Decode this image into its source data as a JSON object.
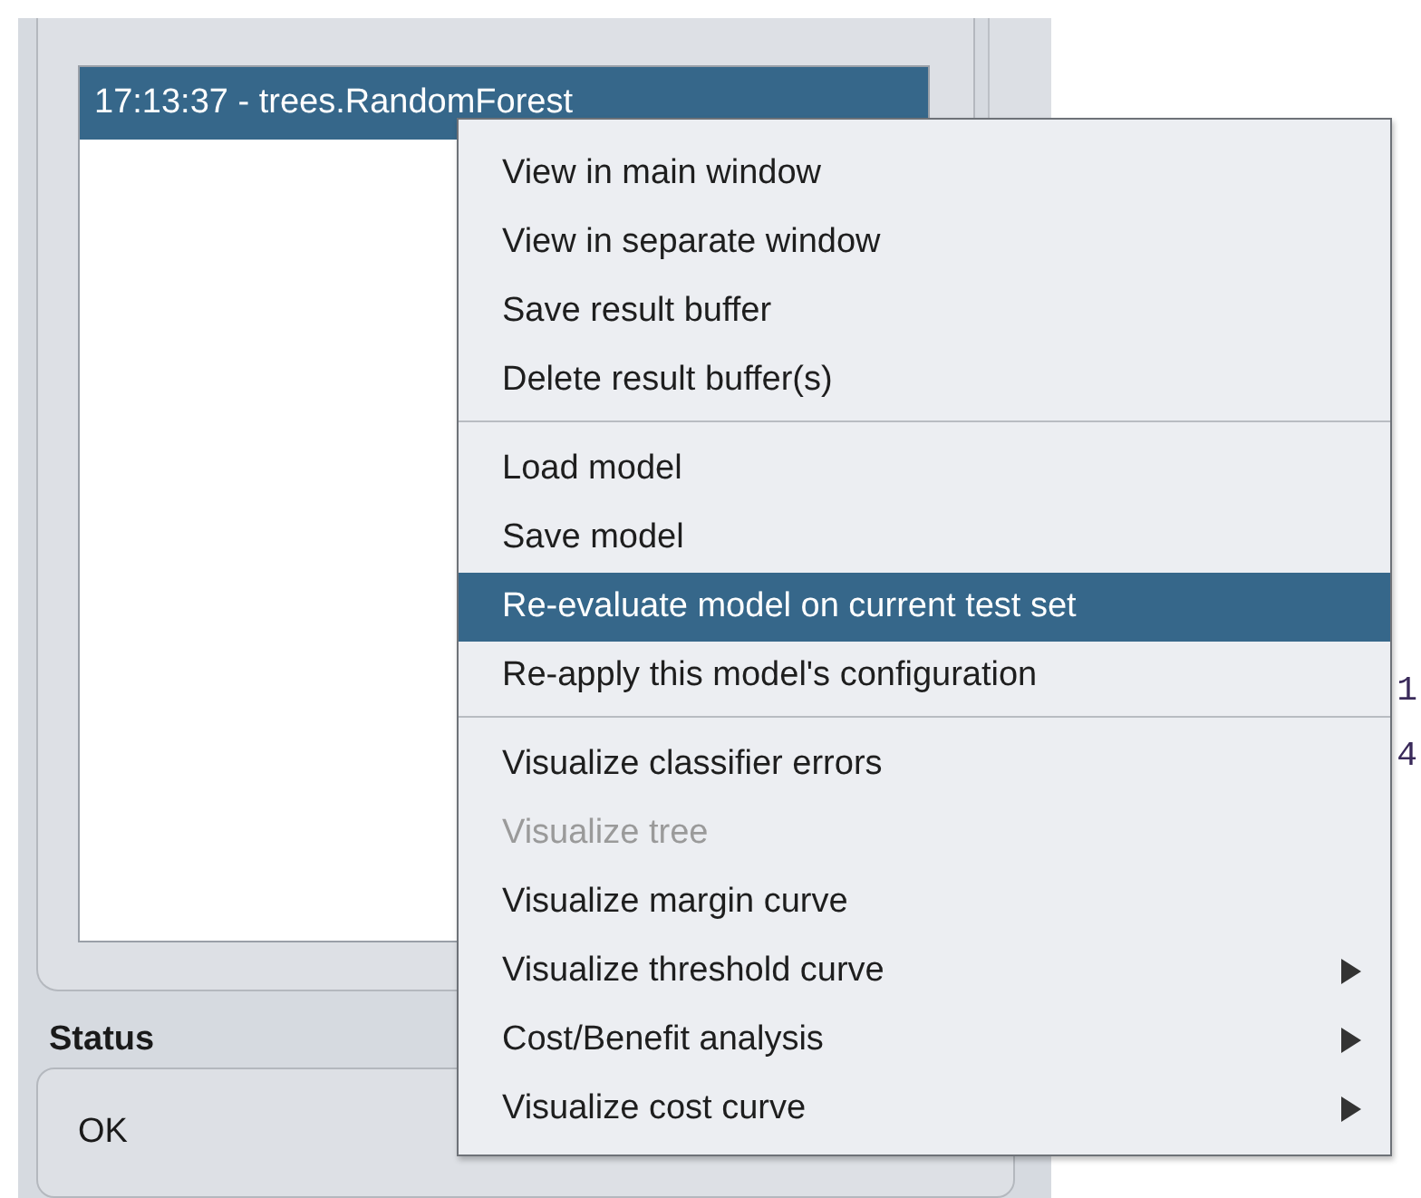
{
  "results": {
    "items": [
      {
        "label": "17:13:37 - trees.RandomForest",
        "selected": true
      }
    ]
  },
  "status": {
    "label": "Status",
    "text": "OK"
  },
  "output_fragments": [
    "1",
    "4"
  ],
  "menu": {
    "groups": [
      {
        "items": [
          {
            "label": "View in main window",
            "selected": false,
            "disabled": false,
            "submenu": false
          },
          {
            "label": "View in separate window",
            "selected": false,
            "disabled": false,
            "submenu": false
          },
          {
            "label": "Save result buffer",
            "selected": false,
            "disabled": false,
            "submenu": false
          },
          {
            "label": "Delete result buffer(s)",
            "selected": false,
            "disabled": false,
            "submenu": false
          }
        ]
      },
      {
        "items": [
          {
            "label": "Load model",
            "selected": false,
            "disabled": false,
            "submenu": false
          },
          {
            "label": "Save model",
            "selected": false,
            "disabled": false,
            "submenu": false
          },
          {
            "label": "Re-evaluate model on current test set",
            "selected": true,
            "disabled": false,
            "submenu": false
          },
          {
            "label": "Re-apply this model's configuration",
            "selected": false,
            "disabled": false,
            "submenu": false
          }
        ]
      },
      {
        "items": [
          {
            "label": "Visualize classifier errors",
            "selected": false,
            "disabled": false,
            "submenu": false
          },
          {
            "label": "Visualize tree",
            "selected": false,
            "disabled": true,
            "submenu": false
          },
          {
            "label": "Visualize margin curve",
            "selected": false,
            "disabled": false,
            "submenu": false
          },
          {
            "label": "Visualize threshold curve",
            "selected": false,
            "disabled": false,
            "submenu": true
          },
          {
            "label": "Cost/Benefit analysis",
            "selected": false,
            "disabled": false,
            "submenu": true
          },
          {
            "label": "Visualize cost curve",
            "selected": false,
            "disabled": false,
            "submenu": true
          }
        ]
      }
    ]
  }
}
